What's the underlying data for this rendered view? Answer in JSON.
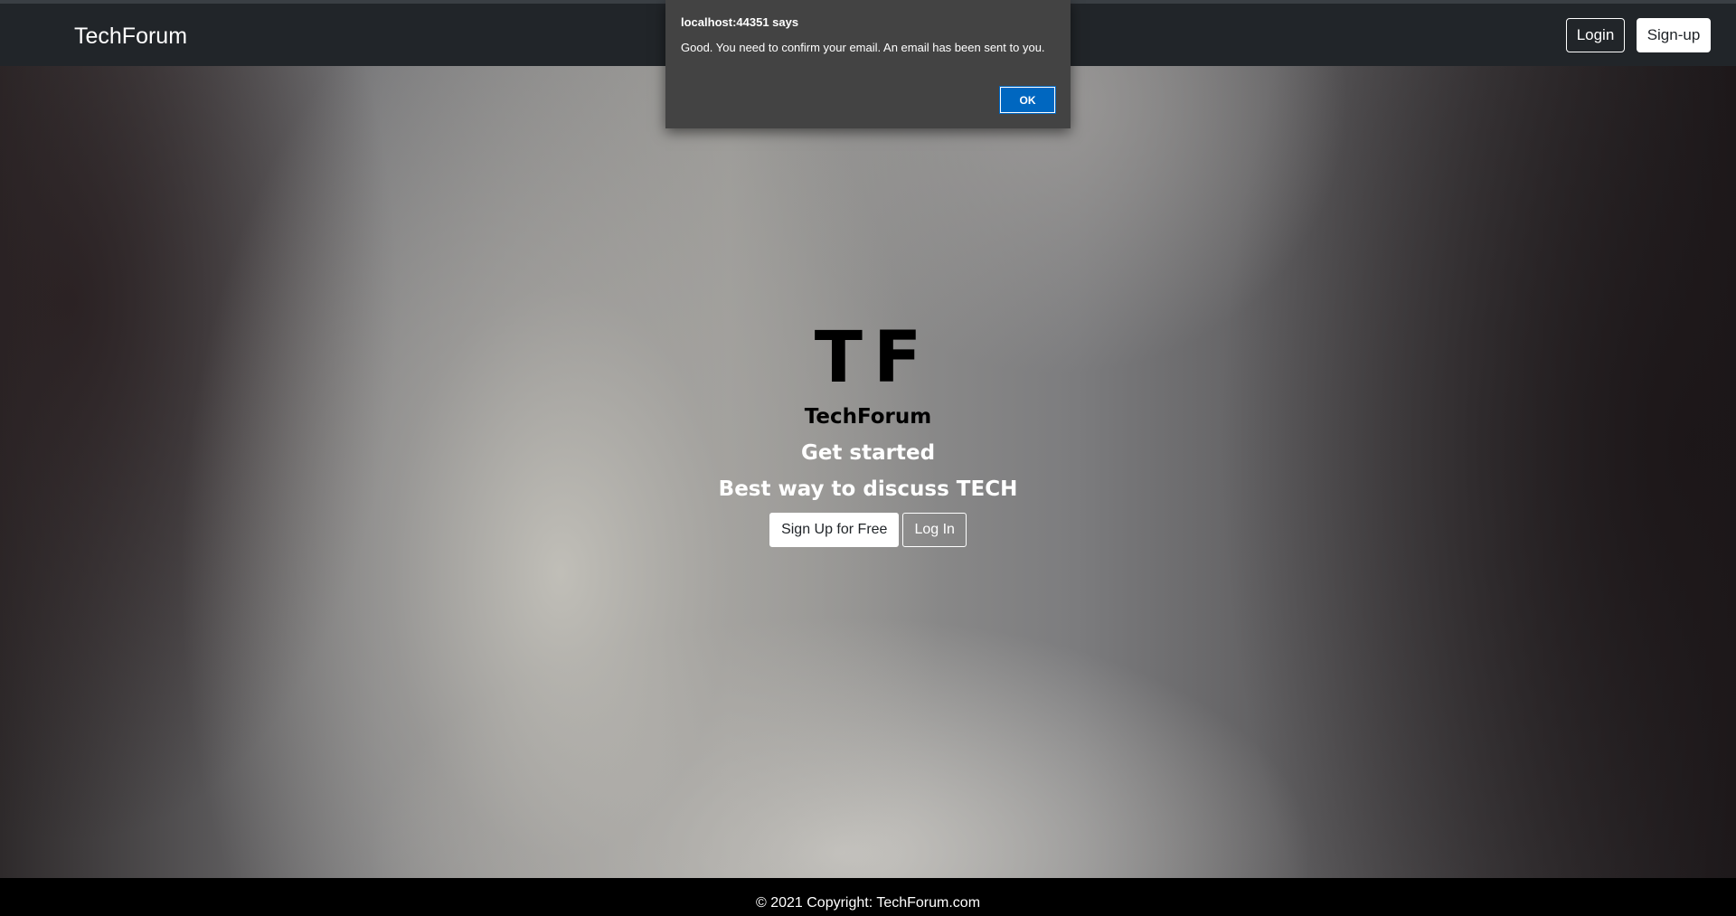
{
  "navbar": {
    "brand": "TechForum",
    "login_label": "Login",
    "signup_label": "Sign-up"
  },
  "hero": {
    "logo_letters": "TF",
    "title": "TechForum",
    "tagline_1": "Get started",
    "tagline_2": "Best way to discuss TECH",
    "signup_button": "Sign Up for Free",
    "login_button": "Log In"
  },
  "footer": {
    "copyright": "© 2021 Copyright: TechForum.com"
  },
  "dialog": {
    "title": "localhost:44351 says",
    "message": "Good. You need to confirm your email. An email has been sent to you.",
    "ok_label": "OK"
  },
  "colors": {
    "navbar_bg": "#212529",
    "footer_bg": "#000000",
    "dialog_bg": "#434343",
    "ok_button": "#0067c0"
  }
}
